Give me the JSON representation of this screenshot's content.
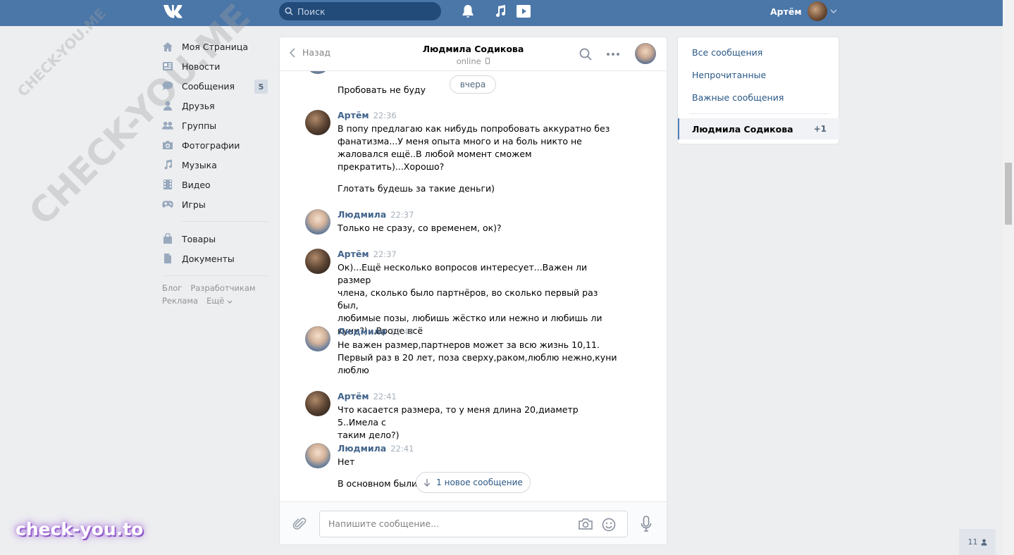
{
  "header": {
    "search_placeholder": "Поиск",
    "user_name": "Артём"
  },
  "sidebar": {
    "items": [
      {
        "label": "Моя Страница",
        "icon": "home-icon"
      },
      {
        "label": "Новости",
        "icon": "news-icon"
      },
      {
        "label": "Сообщения",
        "icon": "messages-icon",
        "badge": "5"
      },
      {
        "label": "Друзья",
        "icon": "friends-icon"
      },
      {
        "label": "Группы",
        "icon": "groups-icon"
      },
      {
        "label": "Фотографии",
        "icon": "camera-icon"
      },
      {
        "label": "Музыка",
        "icon": "music-icon"
      },
      {
        "label": "Видео",
        "icon": "video-icon"
      },
      {
        "label": "Игры",
        "icon": "gamepad-icon"
      }
    ],
    "items2": [
      {
        "label": "Товары",
        "icon": "bag-icon"
      },
      {
        "label": "Документы",
        "icon": "document-icon"
      }
    ],
    "footer": [
      "Блог",
      "Разработчикам",
      "Реклама",
      "Ещё"
    ]
  },
  "chat": {
    "back_label": "Назад",
    "peer_name": "Людмила Содикова",
    "peer_status": "online",
    "date_pill": "вчера",
    "messages": [
      {
        "author": "",
        "time": "",
        "lines": [
          "Пробовать не буду"
        ]
      },
      {
        "author": "Артём",
        "time": "22:36",
        "lines": [
          "В попу предлагаю как нибудь попробовать аккуратно без",
          "фанатизма...У меня опыта много и на боль никто не",
          "жаловался ещё..В любой момент сможем",
          "прекратить)...Хорошо?"
        ],
        "extra": "Глотать будешь за такие деньги)"
      },
      {
        "author": "Людмила",
        "time": "22:37",
        "lines": [
          "Только не сразу, со временем, ок)?"
        ]
      },
      {
        "author": "Артём",
        "time": "22:37",
        "lines": [
          "Ок)...Ещё несколько вопросов интересует...Важен ли размер",
          "члена, сколько было партнёров, во сколько первый раз был,",
          "любимые позы, любишь жёстко или нежно и любишь ли",
          "куни?)...Вроде всё"
        ]
      },
      {
        "author": "Людмила",
        "time": "22:40",
        "lines": [
          "Не важен размер,партнеров может за всю жизнь 10,11.",
          "Первый раз в 20 лет, поза сверху,раком,люблю нежно,куни",
          "люблю"
        ]
      },
      {
        "author": "Артём",
        "time": "22:41",
        "lines": [
          "Что касается размера, то у меня длина 20,диаметр 5..Имела с",
          "таким дело?)"
        ]
      },
      {
        "author": "Людмила",
        "time": "22:41",
        "lines": [
          "Нет"
        ],
        "extra": "В основном были"
      }
    ],
    "new_message_pill": "1 новое сообщение",
    "composer_placeholder": "Напишите сообщение..."
  },
  "rightmenu": {
    "all": "Все сообщения",
    "unread": "Непрочитанные",
    "important": "Важные сообщения",
    "active_name": "Людмила Содикова",
    "active_count": "+1"
  },
  "online_widget": "11",
  "watermarks": {
    "big": "CHECK-YOU.ME",
    "small": "CHECK-YOU.ME",
    "brand": "check-you.to"
  },
  "colors": {
    "header": "#4a76a8",
    "link": "#2a5885",
    "author": "#42648b",
    "background": "#edeef0"
  }
}
